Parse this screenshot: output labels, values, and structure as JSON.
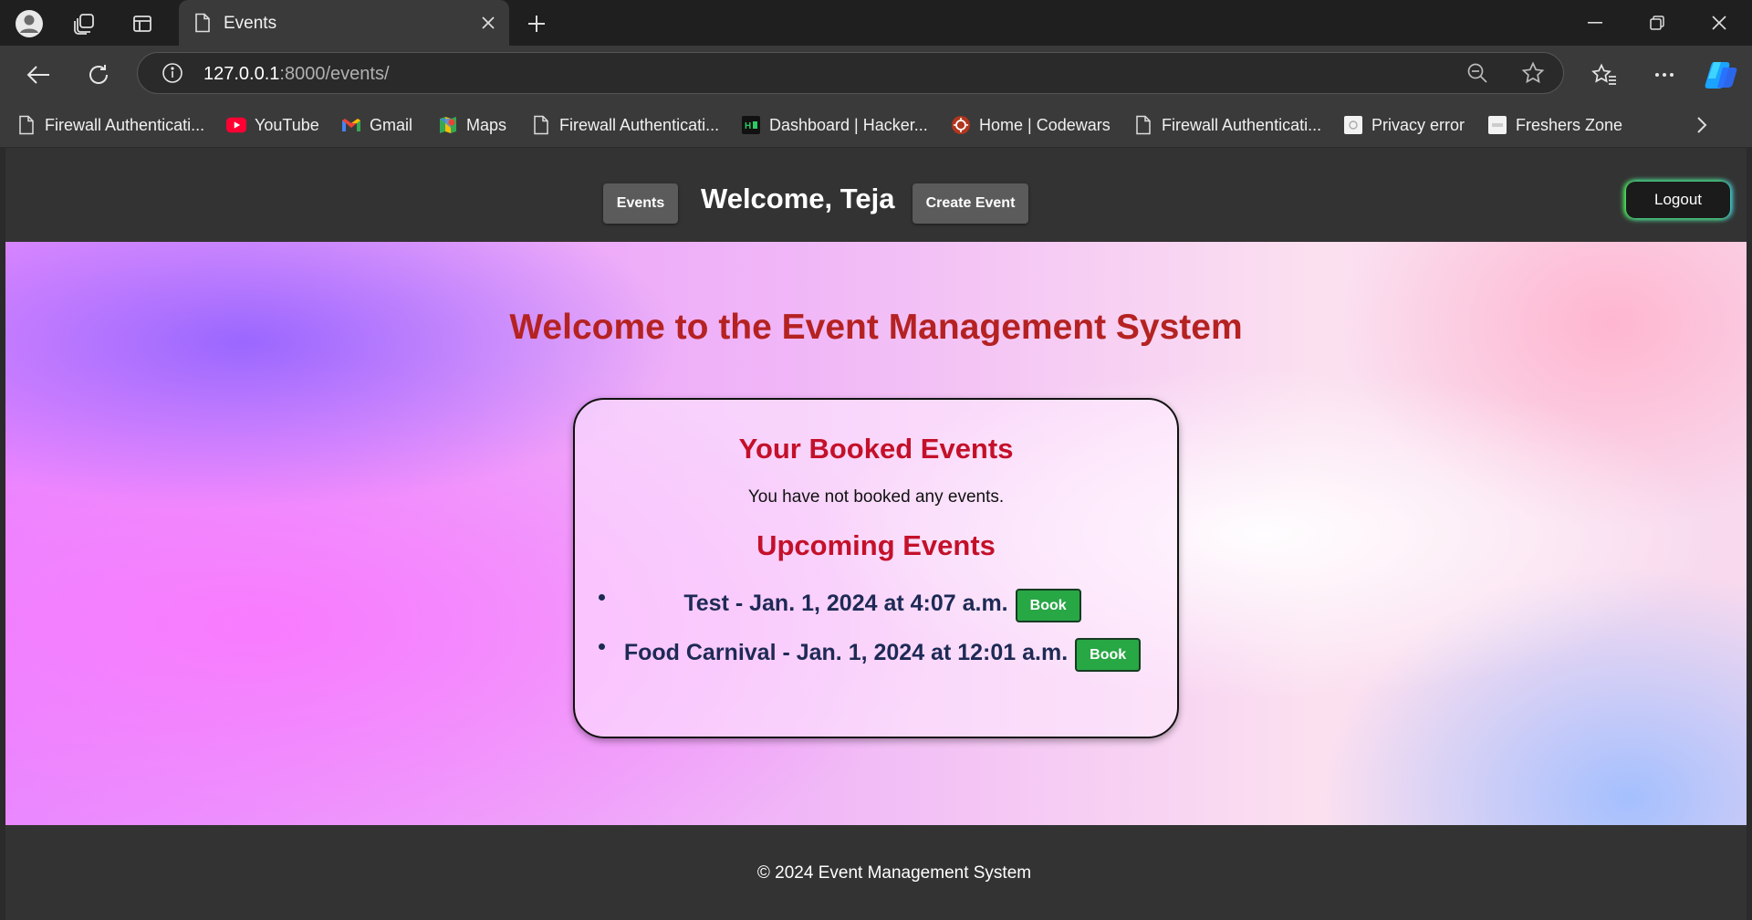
{
  "browser": {
    "tab": {
      "title": "Events"
    },
    "url": {
      "host": "127.0.0.1",
      "path": ":8000/events/"
    },
    "bookmarks": [
      {
        "label": "Firewall Authenticati...",
        "icon": "page-icon"
      },
      {
        "label": "YouTube",
        "icon": "youtube-icon"
      },
      {
        "label": "Gmail",
        "icon": "gmail-icon"
      },
      {
        "label": "Maps",
        "icon": "maps-icon"
      },
      {
        "label": "Firewall Authenticati...",
        "icon": "page-icon"
      },
      {
        "label": "Dashboard | Hacker...",
        "icon": "hackerrank-icon"
      },
      {
        "label": "Home | Codewars",
        "icon": "codewars-icon"
      },
      {
        "label": "Firewall Authenticati...",
        "icon": "page-icon"
      },
      {
        "label": "Privacy error",
        "icon": "privacy-icon"
      },
      {
        "label": "Freshers Zone",
        "icon": "freshers-icon"
      }
    ]
  },
  "nav": {
    "events_label": "Events",
    "welcome": "Welcome, Teja",
    "create_label": "Create Event",
    "logout_label": "Logout"
  },
  "main": {
    "title": "Welcome to the Event Management System",
    "booked_heading": "Your Booked Events",
    "booked_empty": "You have not booked any events.",
    "upcoming_heading": "Upcoming Events",
    "events": [
      {
        "text": "Test - Jan. 1, 2024 at 4:07 a.m.",
        "action": "Book"
      },
      {
        "text": "Food Carnival - Jan. 1, 2024 at 12:01 a.m.",
        "action": "Book"
      }
    ]
  },
  "footer": {
    "text": "© 2024 Event Management System"
  },
  "colors": {
    "heading_red": "#b52222",
    "card_heading": "#c4102a",
    "event_text": "#1d2a55",
    "book_green": "#28a745",
    "navbar": "#333333"
  }
}
